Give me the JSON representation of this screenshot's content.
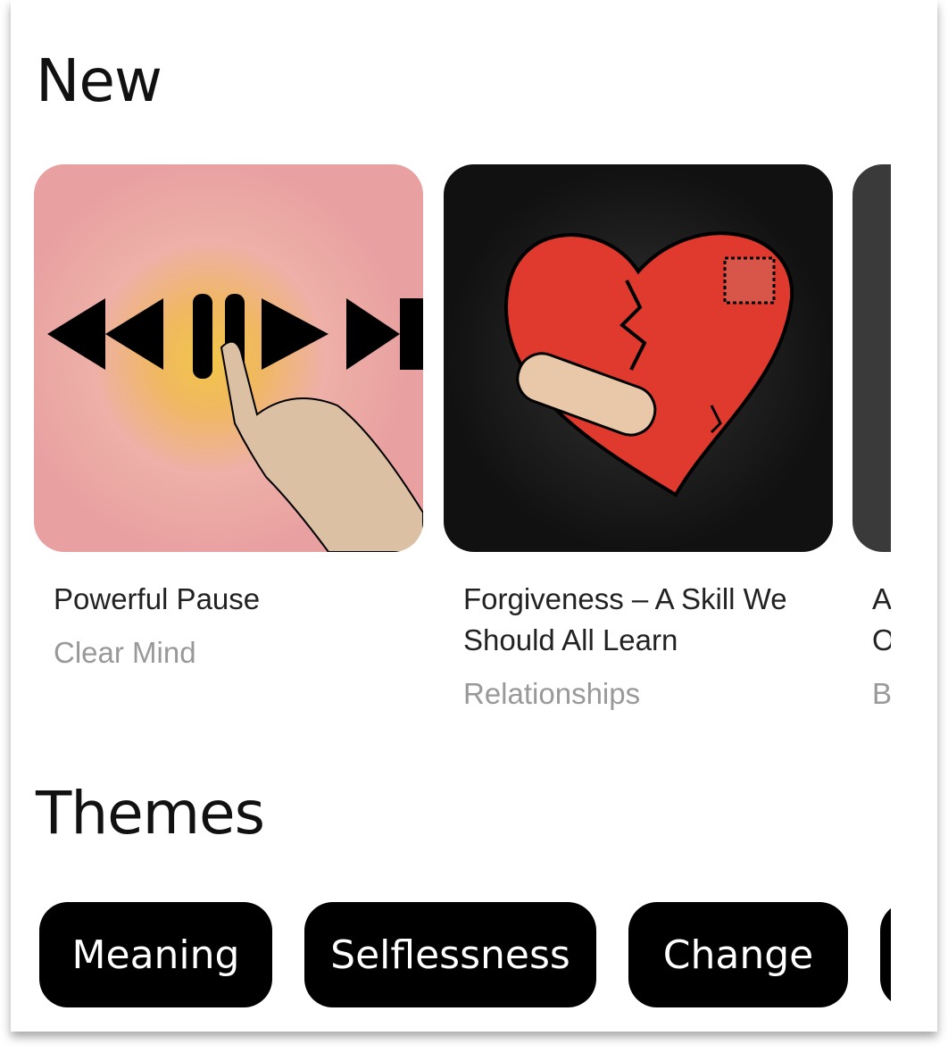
{
  "sections": {
    "new_heading": "New",
    "themes_heading": "Themes"
  },
  "cards": [
    {
      "title": "Powerful Pause",
      "category": "Clear Mind"
    },
    {
      "title": "Forgiveness – A Skill We Should All Learn",
      "category": "Relationships"
    },
    {
      "title": "A O",
      "title_partial_1": "A",
      "title_partial_2": "O",
      "category": "B"
    }
  ],
  "themes": [
    "Meaning",
    "Selflessness",
    "Change"
  ]
}
